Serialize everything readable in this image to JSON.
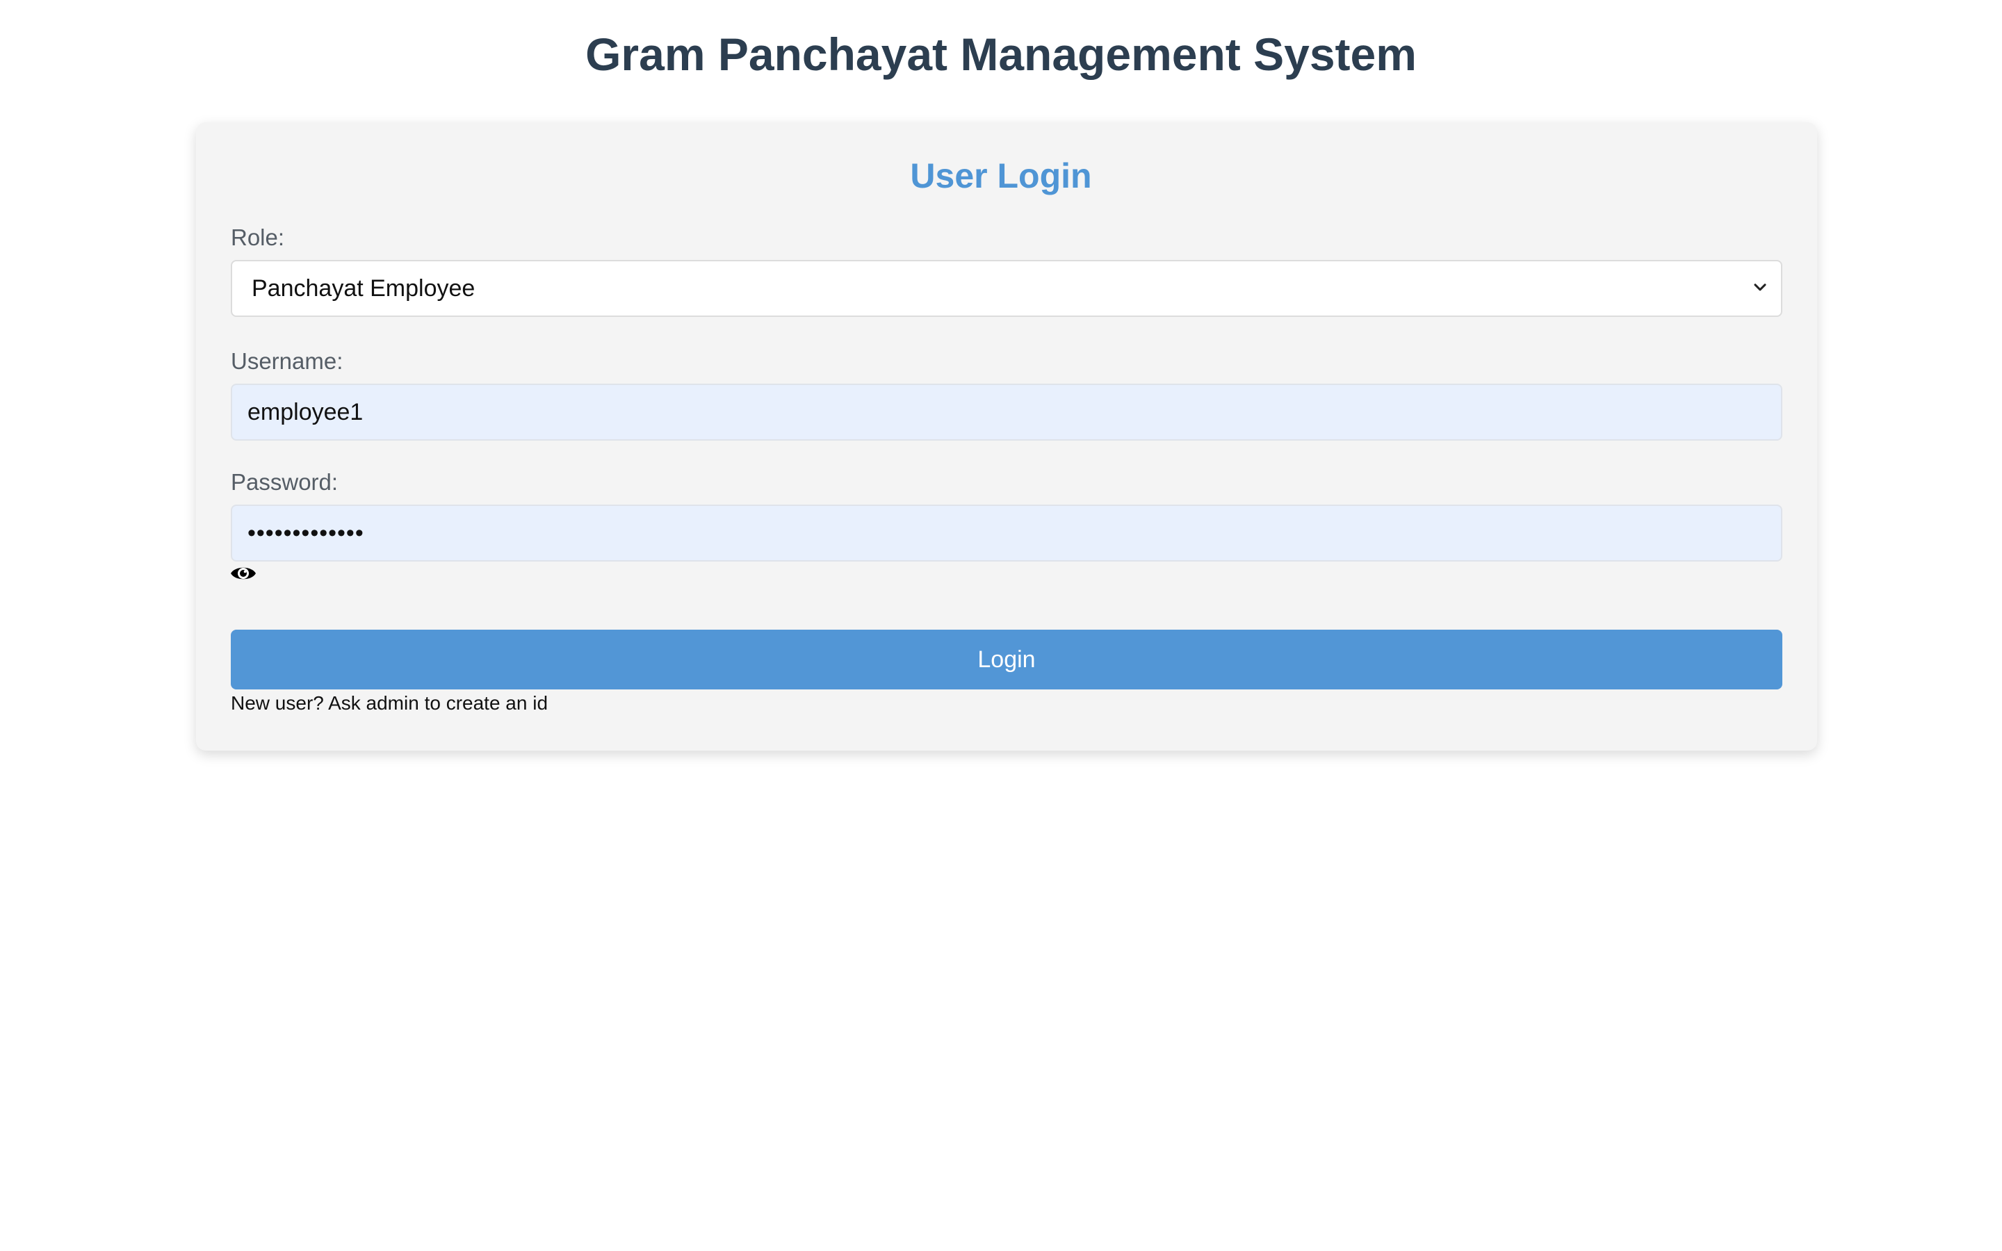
{
  "app": {
    "title": "Gram Panchayat Management System"
  },
  "login_form": {
    "title": "User Login",
    "role_label": "Role:",
    "role_selected": "Panchayat Employee",
    "username_label": "Username:",
    "username_value": "employee1",
    "password_label": "Password:",
    "password_value": "•••••••••••••",
    "show_password_icon": "eye-icon",
    "login_button": "Login",
    "new_user_note": "New user? Ask admin to create an id"
  },
  "colors": {
    "title": "#2c3e50",
    "accent": "#4f95d5",
    "button": "#5296d6",
    "card_background": "#f4f4f4",
    "autofill_background": "#e8f0fd"
  }
}
